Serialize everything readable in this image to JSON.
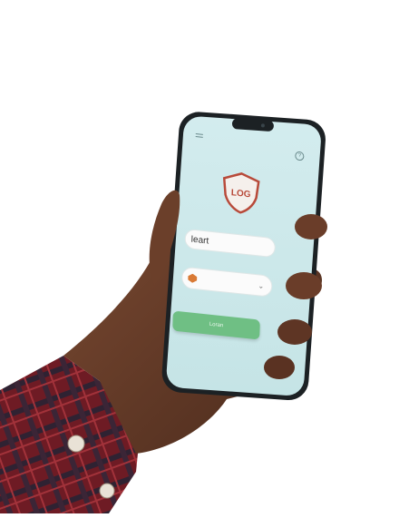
{
  "screen": {
    "logo_text": "LOG",
    "username_label": "",
    "username_value": "leart",
    "account_label": "",
    "account_title": "",
    "account_sub": "",
    "login_label": "Loran"
  },
  "colors": {
    "screen_bg": "#cfe9ea",
    "shield": "#b84a3a",
    "button": "#6fbf84",
    "skin": "#6b3f2a",
    "sleeve_red": "#7a1f27",
    "sleeve_dark": "#2d2230"
  },
  "icons": [
    "menu-icon",
    "help-icon",
    "shield-icon",
    "chevron-down-icon"
  ]
}
